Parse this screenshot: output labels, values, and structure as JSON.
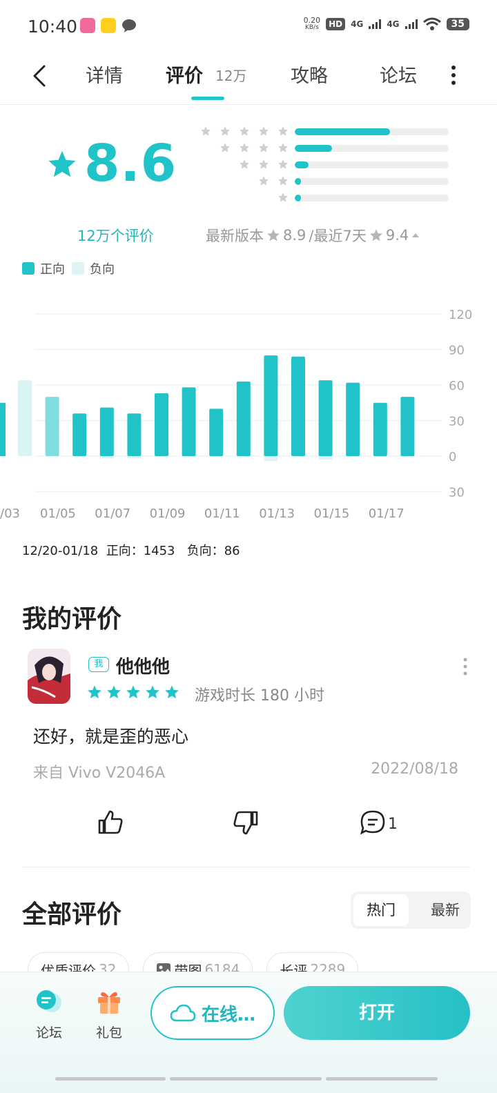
{
  "status": {
    "time": "10:40",
    "net_speed_top": "0.20",
    "net_speed_unit": "KB/s",
    "hd_label": "HD",
    "sim1": "4G",
    "sim2": "4G",
    "battery": "35",
    "app_icons": [
      "bilibili-icon",
      "meituan-icon",
      "message-icon"
    ]
  },
  "nav": {
    "tabs": [
      {
        "label": "详情"
      },
      {
        "label": "评价",
        "count": "12万"
      },
      {
        "label": "攻略"
      },
      {
        "label": "论坛"
      }
    ],
    "active_tab": "评价"
  },
  "rating": {
    "score": "8.6",
    "distribution": [
      {
        "stars": 5,
        "fraction": 0.62
      },
      {
        "stars": 4,
        "fraction": 0.24
      },
      {
        "stars": 3,
        "fraction": 0.09
      },
      {
        "stars": 2,
        "fraction": 0.04
      },
      {
        "stars": 1,
        "fraction": 0.04
      }
    ],
    "review_count_label": "12万个评价",
    "latest_version_label": "最新版本",
    "latest_version_score": "8.9",
    "recent_label": "/最近7天",
    "recent_score": "9.4"
  },
  "legend": {
    "positive": "正向",
    "negative": "负向"
  },
  "chart_data": {
    "type": "bar",
    "categories": [
      "01/03",
      "01/04",
      "01/05",
      "01/06",
      "01/07",
      "01/08",
      "01/09",
      "01/10",
      "01/11",
      "01/12",
      "01/13",
      "01/14",
      "01/15",
      "01/16",
      "01/17",
      "01/18"
    ],
    "x_tick_labels": [
      "/03",
      "01/05",
      "01/07",
      "01/09",
      "01/11",
      "01/13",
      "01/15",
      "01/17"
    ],
    "series": [
      {
        "name": "正向",
        "values": [
          64,
          50,
          36,
          41,
          36,
          53,
          58,
          40,
          63,
          85,
          84,
          64,
          62,
          45,
          50,
          0
        ]
      },
      {
        "name": "负向",
        "values": [
          0,
          0,
          0,
          -2,
          -2,
          0,
          0,
          0,
          0,
          -4,
          0,
          -3,
          0,
          0,
          0,
          0
        ]
      }
    ],
    "extra_left_partial_value": 45,
    "ylim": [
      -30,
      120
    ],
    "y_tick_labels": [
      "120",
      "90",
      "60",
      "30",
      "0",
      "30"
    ],
    "grid": true,
    "legend_position": "top-left"
  },
  "summary": {
    "range": "12/20-01/18",
    "positive_label": "正向：",
    "positive_count": "1453",
    "negative_label": "负向：",
    "negative_count": "86"
  },
  "my_review": {
    "title": "我的评价",
    "me_badge": "我",
    "username": "他他他",
    "stars": 5,
    "playtime": "游戏时长 180 小时",
    "text": "还好，就是歪的恶心",
    "device": "来自 Vivo V2046A",
    "date": "2022/08/18",
    "comment_count": "1"
  },
  "all_reviews": {
    "title": "全部评价",
    "sort_hot": "热门",
    "sort_new": "最新",
    "chips": [
      {
        "label": "优质评价",
        "count": "32"
      },
      {
        "label": "带图",
        "count": "6184",
        "icon": "image-icon"
      },
      {
        "label": "长评",
        "count": "2289"
      }
    ]
  },
  "bottom": {
    "forum": "论坛",
    "gift": "礼包",
    "cloud": "在线…",
    "open": "打开"
  },
  "colors": {
    "accent": "#20c3c8",
    "negative_bar": "#dff3f3",
    "star_gray": "#cfcfcf"
  }
}
